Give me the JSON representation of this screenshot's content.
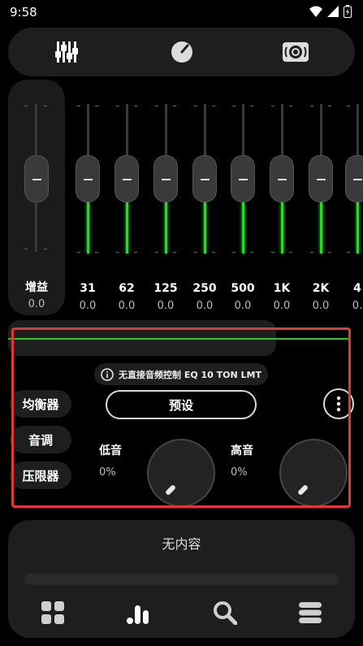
{
  "status": {
    "time": "9:58"
  },
  "gain": {
    "label": "增益",
    "value": "0.0"
  },
  "bands": [
    {
      "freq": "31",
      "value": "0.0"
    },
    {
      "freq": "62",
      "value": "0.0"
    },
    {
      "freq": "125",
      "value": "0.0"
    },
    {
      "freq": "250",
      "value": "0.0"
    },
    {
      "freq": "500",
      "value": "0.0"
    },
    {
      "freq": "1K",
      "value": "0.0"
    },
    {
      "freq": "2K",
      "value": "0.0"
    },
    {
      "freq": "4",
      "value": "0."
    }
  ],
  "info": {
    "text": "无直接音频控制 EQ 10 TON LMT"
  },
  "side_menu": {
    "equalizer": "均衡器",
    "tone": "音调",
    "limiter": "压限器"
  },
  "preset": {
    "label": "预设"
  },
  "bass": {
    "label": "低音",
    "value": "0%"
  },
  "treble": {
    "label": "高音",
    "value": "0%"
  },
  "player": {
    "no_content": "无内容"
  },
  "colors": {
    "accent_green": "#22dd22",
    "highlight_red": "#e03a2f",
    "panel": "#1e1e1e"
  }
}
